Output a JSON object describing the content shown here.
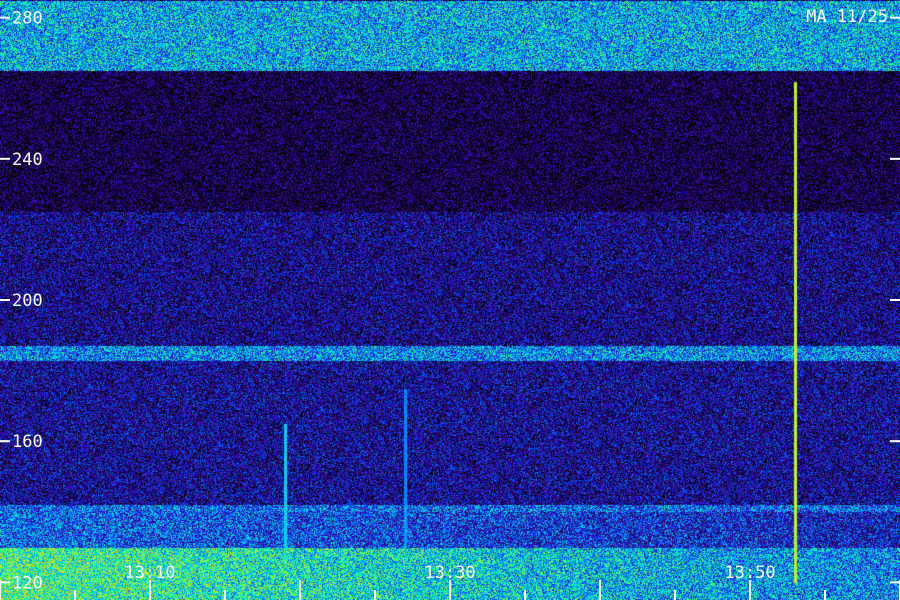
{
  "chart_data": {
    "type": "heatmap",
    "title": "MA 11/25",
    "xlabel": "",
    "ylabel": "",
    "y_ticks": [
      "120",
      "160",
      "200",
      "240",
      "280"
    ],
    "y_range": [
      115,
      285
    ],
    "x_ticks": [
      "13:10",
      "13:30",
      "13:50"
    ],
    "x_range": [
      "13:00",
      "14:00"
    ],
    "colormap": [
      "#000000",
      "#2a0a5e",
      "#3a00c8",
      "#0050ff",
      "#00c8ff",
      "#00ff9a",
      "#a0ff30",
      "#ffd000"
    ],
    "bands": [
      {
        "y_from": 115,
        "y_to": 130,
        "intensity": 0.75
      },
      {
        "y_from": 130,
        "y_to": 142,
        "intensity": 0.45
      },
      {
        "y_from": 142,
        "y_to": 183,
        "intensity": 0.22
      },
      {
        "y_from": 183,
        "y_to": 187,
        "intensity": 0.5
      },
      {
        "y_from": 187,
        "y_to": 225,
        "intensity": 0.2
      },
      {
        "y_from": 225,
        "y_to": 265,
        "intensity": 0.08
      },
      {
        "y_from": 265,
        "y_to": 285,
        "intensity": 0.55
      }
    ],
    "vertical_lines": [
      {
        "time": "13:19",
        "y_from": 125,
        "y_to": 165,
        "intensity": 0.6
      },
      {
        "time": "13:27",
        "y_from": 125,
        "y_to": 175,
        "intensity": 0.5
      },
      {
        "time": "13:53",
        "y_from": 120,
        "y_to": 262,
        "intensity": 0.9
      }
    ]
  }
}
